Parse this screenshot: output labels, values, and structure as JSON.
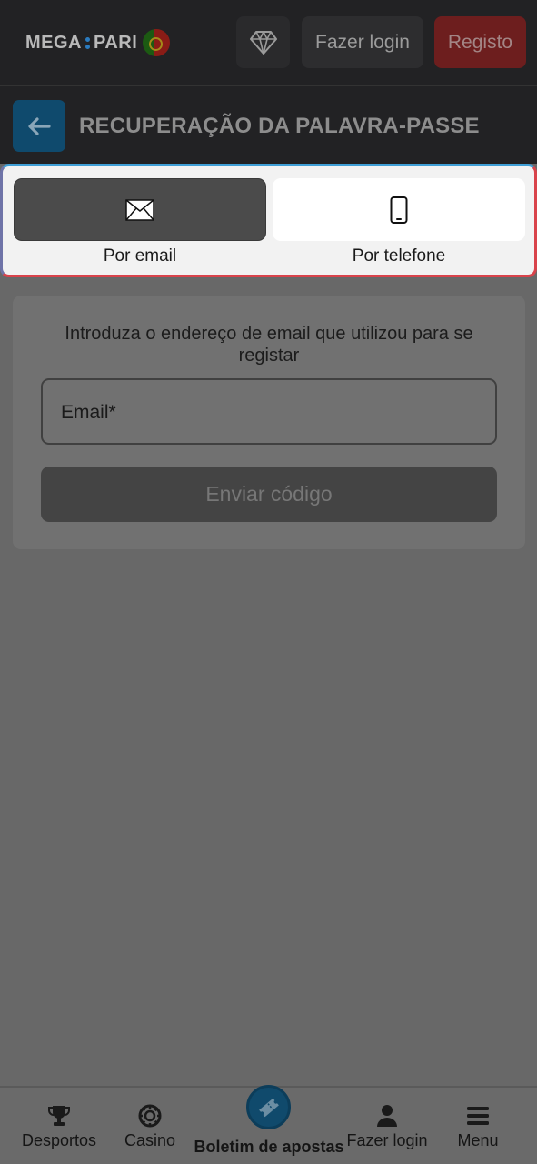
{
  "header": {
    "logo_left": "MEGA",
    "logo_right": "PARI",
    "login_label": "Fazer login",
    "register_label": "Registo"
  },
  "titlebar": {
    "title": "RECUPERAÇÃO DA PALAVRA-PASSE"
  },
  "recovery_methods": {
    "selected": "email",
    "items": [
      {
        "id": "email",
        "label": "Por email",
        "icon": "envelope-icon"
      },
      {
        "id": "phone",
        "label": "Por telefone",
        "icon": "mobile-phone-icon"
      }
    ]
  },
  "form": {
    "instruction": "Introduza o endereço de email que utilizou para se registar",
    "email_placeholder": "Email*",
    "submit_label": "Enviar código"
  },
  "bottom_nav": {
    "items": [
      {
        "label": "Desportos",
        "icon": "trophy-icon"
      },
      {
        "label": "Casino",
        "icon": "casino-chip-icon"
      },
      {
        "label": "Boletim de apostas",
        "icon": "ticket-icon"
      },
      {
        "label": "Fazer login",
        "icon": "user-icon"
      },
      {
        "label": "Menu",
        "icon": "hamburger-menu-icon"
      }
    ]
  },
  "colors": {
    "header_bg": "#222224",
    "overlay_bg": "#686868",
    "register": "#6d1e1e",
    "accent_blue": "#0f4a6d",
    "highlight_border_top": "#3f9fd6",
    "highlight_border_bottom": "#d9434b"
  }
}
